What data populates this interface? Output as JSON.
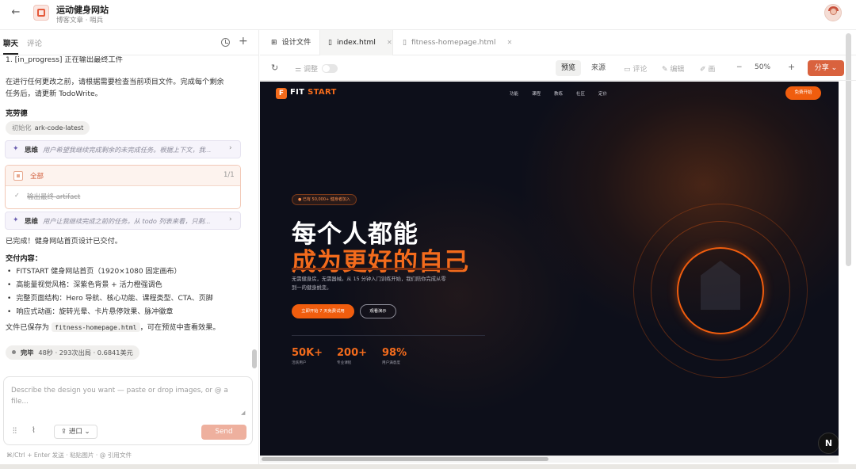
{
  "header": {
    "back_icon": "arrow-left-icon",
    "project_title": "运动健身网站",
    "project_subtitle": "博客文章 · 哨兵"
  },
  "left_tabs": {
    "chat": "聊天",
    "comments": "评论"
  },
  "chat": {
    "progress_line": "1. [in_progress] 正在输出最终工件",
    "instruction_line1": "在进行任何更改之前，请根据需要检查当前项目文件。完成每个剩余",
    "instruction_line2": "任务后，请更新 TodoWrite。",
    "author": "克劳德",
    "init_chip_label": "初始化",
    "init_chip_value": "ark-code-latest",
    "think1_label": "思维",
    "think1_text": "用户希望我继续完成剩余的未完成任务。根据上下文，我...",
    "todo_header": "全部",
    "todo_count": "1/1",
    "todo_item": "输出最终 artifact",
    "think2_label": "思维",
    "think2_text": "用户让我继续完成之前的任务。从 todo 列表来看，只剩...",
    "done_line": "已完成！健身网站首页设计已交付。",
    "deliver_title": "交付内容：",
    "bullets": [
      "FITSTART 健身网站首页（1920×1080 固定画布）",
      "高能量视觉风格：深紫色背景 + 活力橙强调色",
      "完整页面结构：Hero 导航、核心功能、课程类型、CTA、页脚",
      "响应式动画：旋转光晕、卡片悬停效果、脉冲徽章"
    ],
    "saved_prefix": "文件已保存为",
    "saved_file": "fitness-homepage.html",
    "saved_suffix": "，可在预览中查看效果。",
    "done_chip_label": "完毕",
    "done_chip_stats": "48秒 · 293次出局 · 0.6841美元"
  },
  "composer": {
    "placeholder": "Describe the design you want — paste or drop images, or @ a file...",
    "import_label": "进口",
    "send_label": "Send",
    "hint": "⌘/Ctrl + Enter 发送 · 粘贴图片 · @ 引用文件"
  },
  "file_tabs": {
    "design_files": "设计文件",
    "tab1": "index.html",
    "tab2": "fitness-homepage.html"
  },
  "toolbar": {
    "tweak": "调整",
    "preview": "预览",
    "source": "来源",
    "comment": "评论",
    "edit": "编辑",
    "draw": "画",
    "zoom": "50%",
    "share": "分享"
  },
  "site": {
    "logo_letter": "F",
    "brand_a": "FIT",
    "brand_b": "START",
    "nav": [
      "功能",
      "课程",
      "教练",
      "社区",
      "定价"
    ],
    "nav_cta": "免费开始",
    "badge": "● 已有 50,000+ 健身者加入",
    "headline1": "每个人都能",
    "headline2": "成为更好的自己",
    "subtitle": "无需健身房，无需器械。从 15 分钟入门训练开始，我们陪你完成从零到一的健身蜕变。",
    "btn_primary": "立即开始 7 天免费试用",
    "btn_ghost": "观看演示",
    "stats": [
      {
        "value": "50K+",
        "label": "活跃用户"
      },
      {
        "value": "200+",
        "label": "专业课程"
      },
      {
        "value": "98%",
        "label": "用户满意度"
      }
    ],
    "fab": "N"
  },
  "colors": {
    "accent": "#f36b1c",
    "share": "#d9623e",
    "preview_bg": "#0d0f1a"
  }
}
